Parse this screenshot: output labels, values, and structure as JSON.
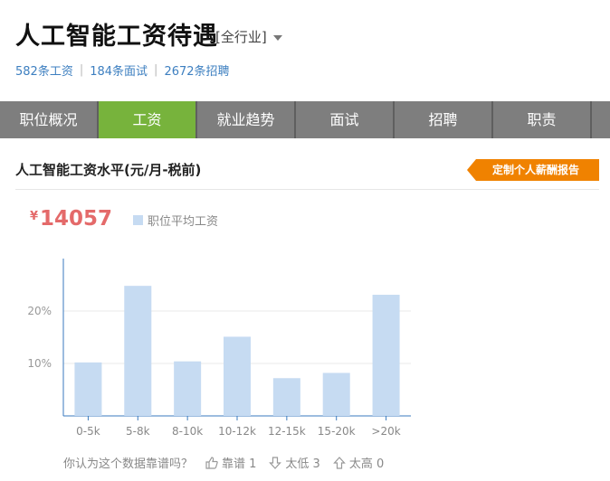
{
  "header": {
    "title": "人工智能工资待遇",
    "industry_filter": "[全行业]"
  },
  "stats": [
    {
      "label": "582条工资"
    },
    {
      "label": "184条面试"
    },
    {
      "label": "2672条招聘"
    }
  ],
  "tabs": [
    {
      "label": "职位概况"
    },
    {
      "label": "工资"
    },
    {
      "label": "就业趋势"
    },
    {
      "label": "面试"
    },
    {
      "label": "招聘"
    },
    {
      "label": "职责"
    }
  ],
  "section": {
    "title": "人工智能工资水平(元/月-税前)",
    "report_button": "定制个人薪酬报告"
  },
  "summary": {
    "currency": "¥",
    "average": "14057",
    "legend_label": "职位平均工资"
  },
  "chart_data": {
    "type": "bar",
    "categories": [
      "0-5k",
      "5-8k",
      "8-10k",
      "10-12k",
      "12-15k",
      "15-20k",
      ">20k"
    ],
    "values": [
      10.2,
      24.8,
      10.4,
      15.1,
      7.2,
      8.2,
      23.1
    ],
    "y_ticks": [
      10,
      20
    ],
    "y_tick_labels": [
      "10%",
      "20%"
    ],
    "ylim": [
      0,
      30
    ],
    "bar_color": "#c6dbf2",
    "grid": true
  },
  "feedback": {
    "question": "你认为这个数据靠谱吗？",
    "reliable": "靠谱 1",
    "too_low": "太低 3",
    "too_high": "太高 0"
  }
}
